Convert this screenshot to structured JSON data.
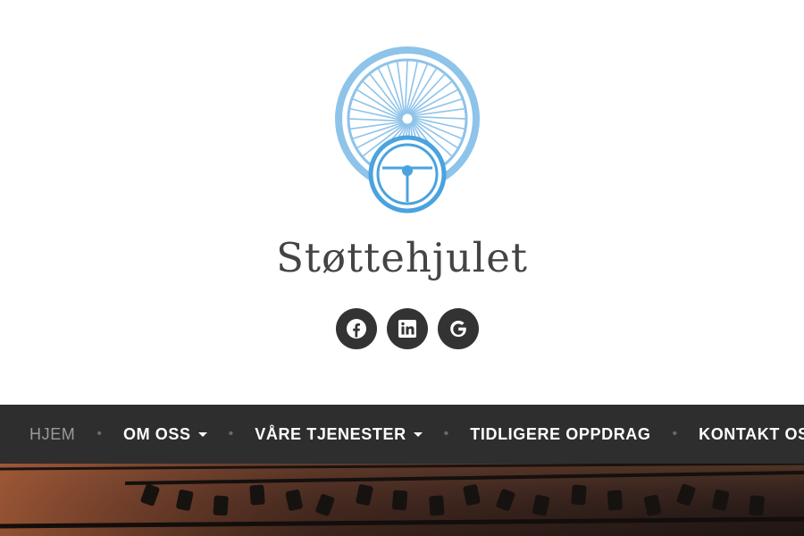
{
  "site": {
    "title": "Støttehjulet"
  },
  "social": [
    {
      "name": "facebook",
      "icon": "facebook-icon"
    },
    {
      "name": "linkedin",
      "icon": "linkedin-icon"
    },
    {
      "name": "google",
      "icon": "google-icon"
    }
  ],
  "nav": {
    "items": [
      {
        "label": "HJEM",
        "active": true,
        "dropdown": false
      },
      {
        "label": "OM OSS",
        "active": false,
        "dropdown": true
      },
      {
        "label": "VÅRE TJENESTER",
        "active": false,
        "dropdown": true
      },
      {
        "label": "TIDLIGERE OPPDRAG",
        "active": false,
        "dropdown": false
      },
      {
        "label": "KONTAKT OSS",
        "active": false,
        "dropdown": false
      }
    ],
    "separator": "•"
  },
  "colors": {
    "nav_bg": "#2e2e2e",
    "logo_blue": "#8ec3ea",
    "logo_dark_blue": "#4aa3df",
    "social_bg": "#333333"
  }
}
